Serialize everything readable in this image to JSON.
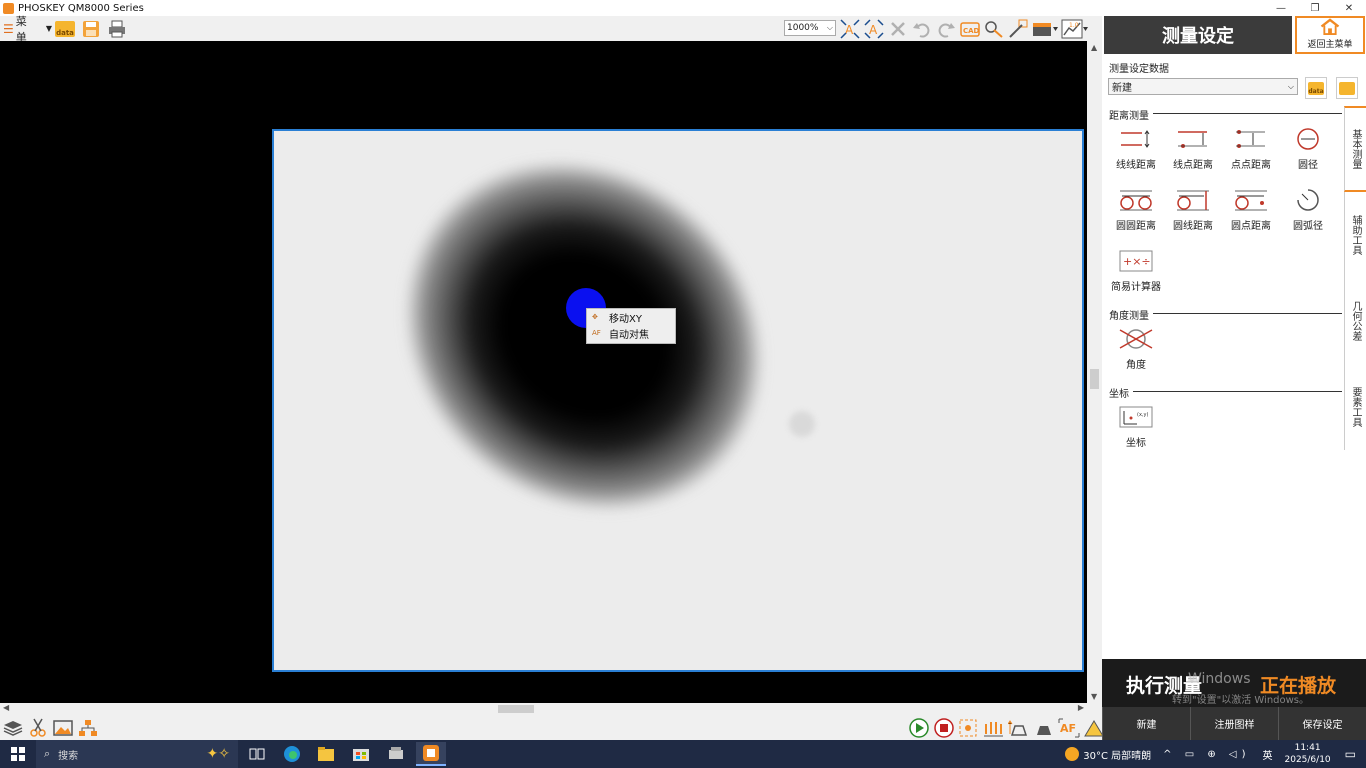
{
  "window": {
    "title": "PHOSKEY QM8000 Series",
    "controls": [
      "—",
      "❐",
      "✕"
    ]
  },
  "toolbar": {
    "menu_label": "菜单",
    "data_label": "data",
    "zoom_value": "1000%"
  },
  "viewport": {
    "context_menu": [
      {
        "label": "移动XY"
      },
      {
        "label": "自动对焦"
      }
    ]
  },
  "panel": {
    "header": "测量设定",
    "home_label": "返回主菜单",
    "setting_data_label": "测量设定数据",
    "setting_selected": "新建",
    "sections": {
      "distance": "距离测量",
      "angle": "角度测量",
      "coordinate": "坐标"
    },
    "distance_tools": [
      {
        "label": "线线距离"
      },
      {
        "label": "线点距离"
      },
      {
        "label": "点点距离"
      },
      {
        "label": "圆径"
      },
      {
        "label": "圆圆距离"
      },
      {
        "label": "圆线距离"
      },
      {
        "label": "圆点距离"
      },
      {
        "label": "圆弧径"
      },
      {
        "label": "简易计算器"
      }
    ],
    "angle_tool": {
      "label": "角度"
    },
    "coord_tool": {
      "label": "坐标"
    },
    "side_tabs": [
      "基本测量",
      "辅助工具",
      "几何公差",
      "要素工具"
    ],
    "exec_label": "执行测量",
    "playing_label": "正在播放",
    "watermark_line1": "Windows",
    "watermark_line2": "转到\"设置\"以激活 Windows。",
    "buttons": [
      "新建",
      "注册图样",
      "保存设定"
    ]
  },
  "taskbar": {
    "search_placeholder": "搜索",
    "weather": "30°C 局部晴朗",
    "ime": "英",
    "time": "11:41",
    "date": "2025/6/10"
  },
  "colors": {
    "accent": "#f08a24",
    "panel_dark": "#3b3b3b",
    "cursor_dot": "#0a10f0",
    "camera_border": "#2a7fd4"
  }
}
